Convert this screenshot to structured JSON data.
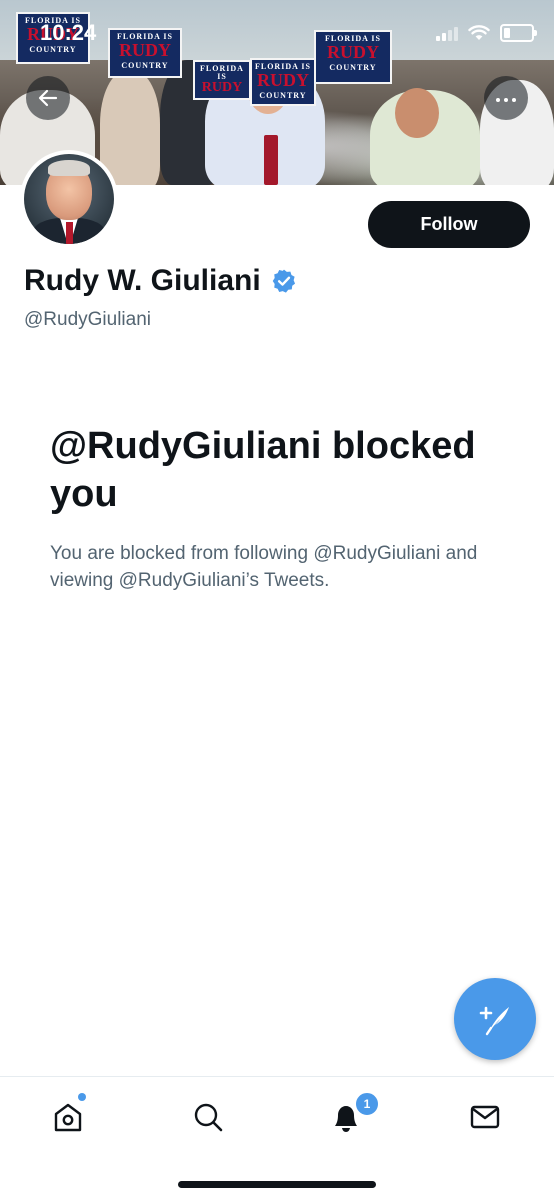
{
  "status_bar": {
    "time": "10:24"
  },
  "banner": {
    "signs": [
      {
        "small": "FLORIDA IS",
        "big": "RUDY",
        "small2": "COUNTRY"
      },
      {
        "small": "FLORIDA IS",
        "big": "RUDY",
        "small2": "COUNTRY"
      },
      {
        "small": "FLORIDA IS",
        "big": "RUDY",
        "small2": "COUNTRY"
      },
      {
        "small": "FLORIDA IS",
        "big": "RUDY",
        "small2": "COUNTRY"
      },
      {
        "small": "FLORIDA IS",
        "big": "RUDY",
        "small2": "COUNTRY"
      }
    ]
  },
  "profile": {
    "follow_label": "Follow",
    "name": "Rudy W. Giuliani",
    "handle": "@RudyGiuliani",
    "verified": true
  },
  "blocked": {
    "title": "@RudyGiuliani blocked you",
    "description": "You are blocked from following @RudyGiuliani and viewing @RudyGiuliani’s Tweets."
  },
  "bottom_nav": {
    "items": [
      "home-icon",
      "search-icon",
      "bell-icon",
      "mail-icon"
    ],
    "notification_count": "1",
    "home_has_new": true
  },
  "colors": {
    "accent": "#4a99e9",
    "text_primary": "#0f1419",
    "text_secondary": "#536471"
  }
}
